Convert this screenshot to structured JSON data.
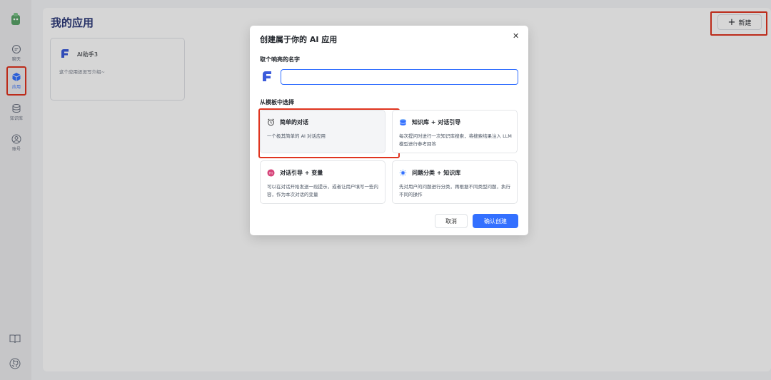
{
  "sidebar": {
    "items": [
      {
        "label": "聊天",
        "icon": "chat-icon"
      },
      {
        "label": "应用",
        "icon": "cube-icon"
      },
      {
        "label": "知识库",
        "icon": "database-icon"
      },
      {
        "label": "账号",
        "icon": "user-icon"
      }
    ],
    "bottom_icons": [
      "book-icon",
      "github-icon"
    ]
  },
  "main": {
    "title": "我的应用",
    "new_button": {
      "icon": "plus-icon",
      "label": "新建"
    },
    "apps": [
      {
        "name": "AI助手3",
        "desc": "这个应用还没写介绍~"
      }
    ]
  },
  "modal": {
    "title": "创建属于你的 AI 应用",
    "close_icon": "close-icon",
    "name_label": "取个响亮的名字",
    "name_value": "",
    "template_label": "从模板中选择",
    "templates": [
      {
        "name": "简单的对话",
        "desc": "一个极其简单的 AI 对话应用",
        "icon": "alarm-icon",
        "selected": true
      },
      {
        "name": "知识库 + 对话引导",
        "desc": "每次提问时进行一次知识库搜索，将搜索结果注入 LLM 模型进行参考回答",
        "icon": "database-icon",
        "selected": false
      },
      {
        "name": "对话引导 + 变量",
        "desc": "可以在对话开始发送一段提示，或者让用户填写一些内容，作为本次对话的变量",
        "icon": "chat-badge-icon",
        "selected": false
      },
      {
        "name": "问题分类 + 知识库",
        "desc": "先对用户的问题进行分类，再根据不同类型问题，执行不同的操作",
        "icon": "classify-icon",
        "selected": false
      }
    ],
    "cancel_label": "取消",
    "confirm_label": "确认创建"
  },
  "colors": {
    "accent": "#3370ff",
    "highlight": "#e0341f",
    "title": "#2e3b7a"
  }
}
